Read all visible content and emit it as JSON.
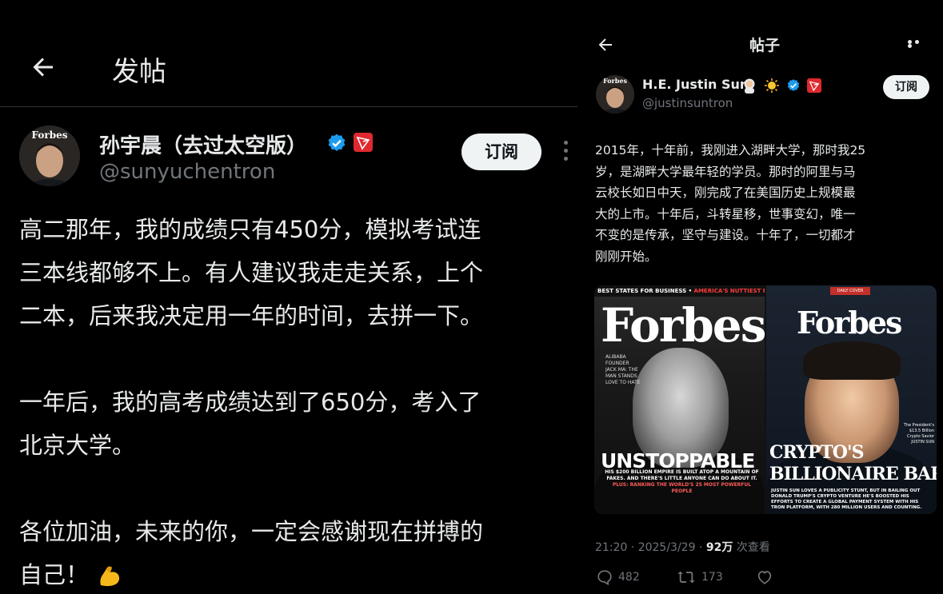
{
  "left": {
    "header_title": "发帖",
    "author_name": "孙宇晨（去过太空版）",
    "author_handle": "@sunyuchentron",
    "subscribe_label": "订阅",
    "avatar_text": "Forbes",
    "paragraphs": [
      "高二那年，我的成绩只有450分，模拟考试连",
      "三本线都够不上。有人建议我走走关系，上个",
      "二本，后来我决定用一年的时间，去拼一下。",
      "一年后，我的高考成绩达到了650分，考入了",
      "北京大学。",
      "各位加油，未来的你，一定会感谢现在拼搏的",
      "自己！"
    ],
    "icons": [
      "back-arrow-icon",
      "verified-badge-icon",
      "tron-logo-icon",
      "more-vertical-icon",
      "flexed-biceps-emoji"
    ]
  },
  "right": {
    "header_title": "帖子",
    "author_name": "H.E. Justin Sun",
    "author_handle": "@justinsuntron",
    "subscribe_label": "订阅",
    "avatar_text": "Forbes",
    "body_lines": [
      "2015年，十年前，我刚进入湖畔大学，那时我25",
      "岁，是湖畔大学最年轻的学员。那时的阿里与马",
      "云校长如日中天，刚完成了在美国历史上规模最",
      "大的上市。十年后，斗转星移，世事变幻，唯一",
      "不变的是传承，坚守与建设。十年了，一切都才",
      "刚刚开始。"
    ],
    "cover1": {
      "topline_white": "BEST STATES FOR BUSINESS • ",
      "topline_red": "AMERICA'S NUTTIEST POWER COUPLE",
      "masthead": "Forbes",
      "side_text": "ALIBABA FOUNDER JACK MA: THE MAN STANDS LOVE TO HATE",
      "headline": "UNSTOPPABLE",
      "subline": "HIS $200 BILLION EMPIRE IS BUILT ATOP A MOUNTAIN OF FAKES. AND THERE'S LITTLE ANYONE CAN DO ABOUT IT.",
      "subline_red": "PLUS: RANKING THE WORLD'S 25 MOST POWERFUL PEOPLE"
    },
    "cover2": {
      "badge": "DAILY COVER",
      "masthead": "Forbes",
      "side_text": "The President's $13.5 Billion Crypto Savior JUSTIN SUN",
      "headline_line1": "CRYPTO'S",
      "headline_line2": "BILLIONAIRE BARKER",
      "subline": "JUSTIN SUN LOVES A PUBLICITY STUNT, BUT IN BAILING OUT DONALD TRUMP'S CRYPTO VENTURE HE'S BOOSTED HIS EFFORTS TO CREATE A GLOBAL PAYMENT SYSTEM WITH HIS TRON PLATFORM, WITH 280 MILLION USERS AND COUNTING."
    },
    "meta": {
      "time": "21:20 · 2025/3/29 · ",
      "views": "92万",
      "views_label": " 次查看"
    },
    "actions": {
      "replies": "482",
      "reposts": "173"
    },
    "badges": [
      "astronaut-emoji",
      "sun-emoji",
      "verified-badge-icon",
      "tron-logo-icon"
    ],
    "icons": [
      "back-arrow-icon",
      "more-horizontal-icon",
      "reply-icon",
      "repost-icon",
      "like-icon"
    ]
  },
  "colors": {
    "background": "#000000",
    "text_primary": "#e7e9ea",
    "text_secondary": "#71767b",
    "verified_blue": "#1d9bf0",
    "tron_red": "#e0282f",
    "button_bg": "#eff3f4"
  }
}
